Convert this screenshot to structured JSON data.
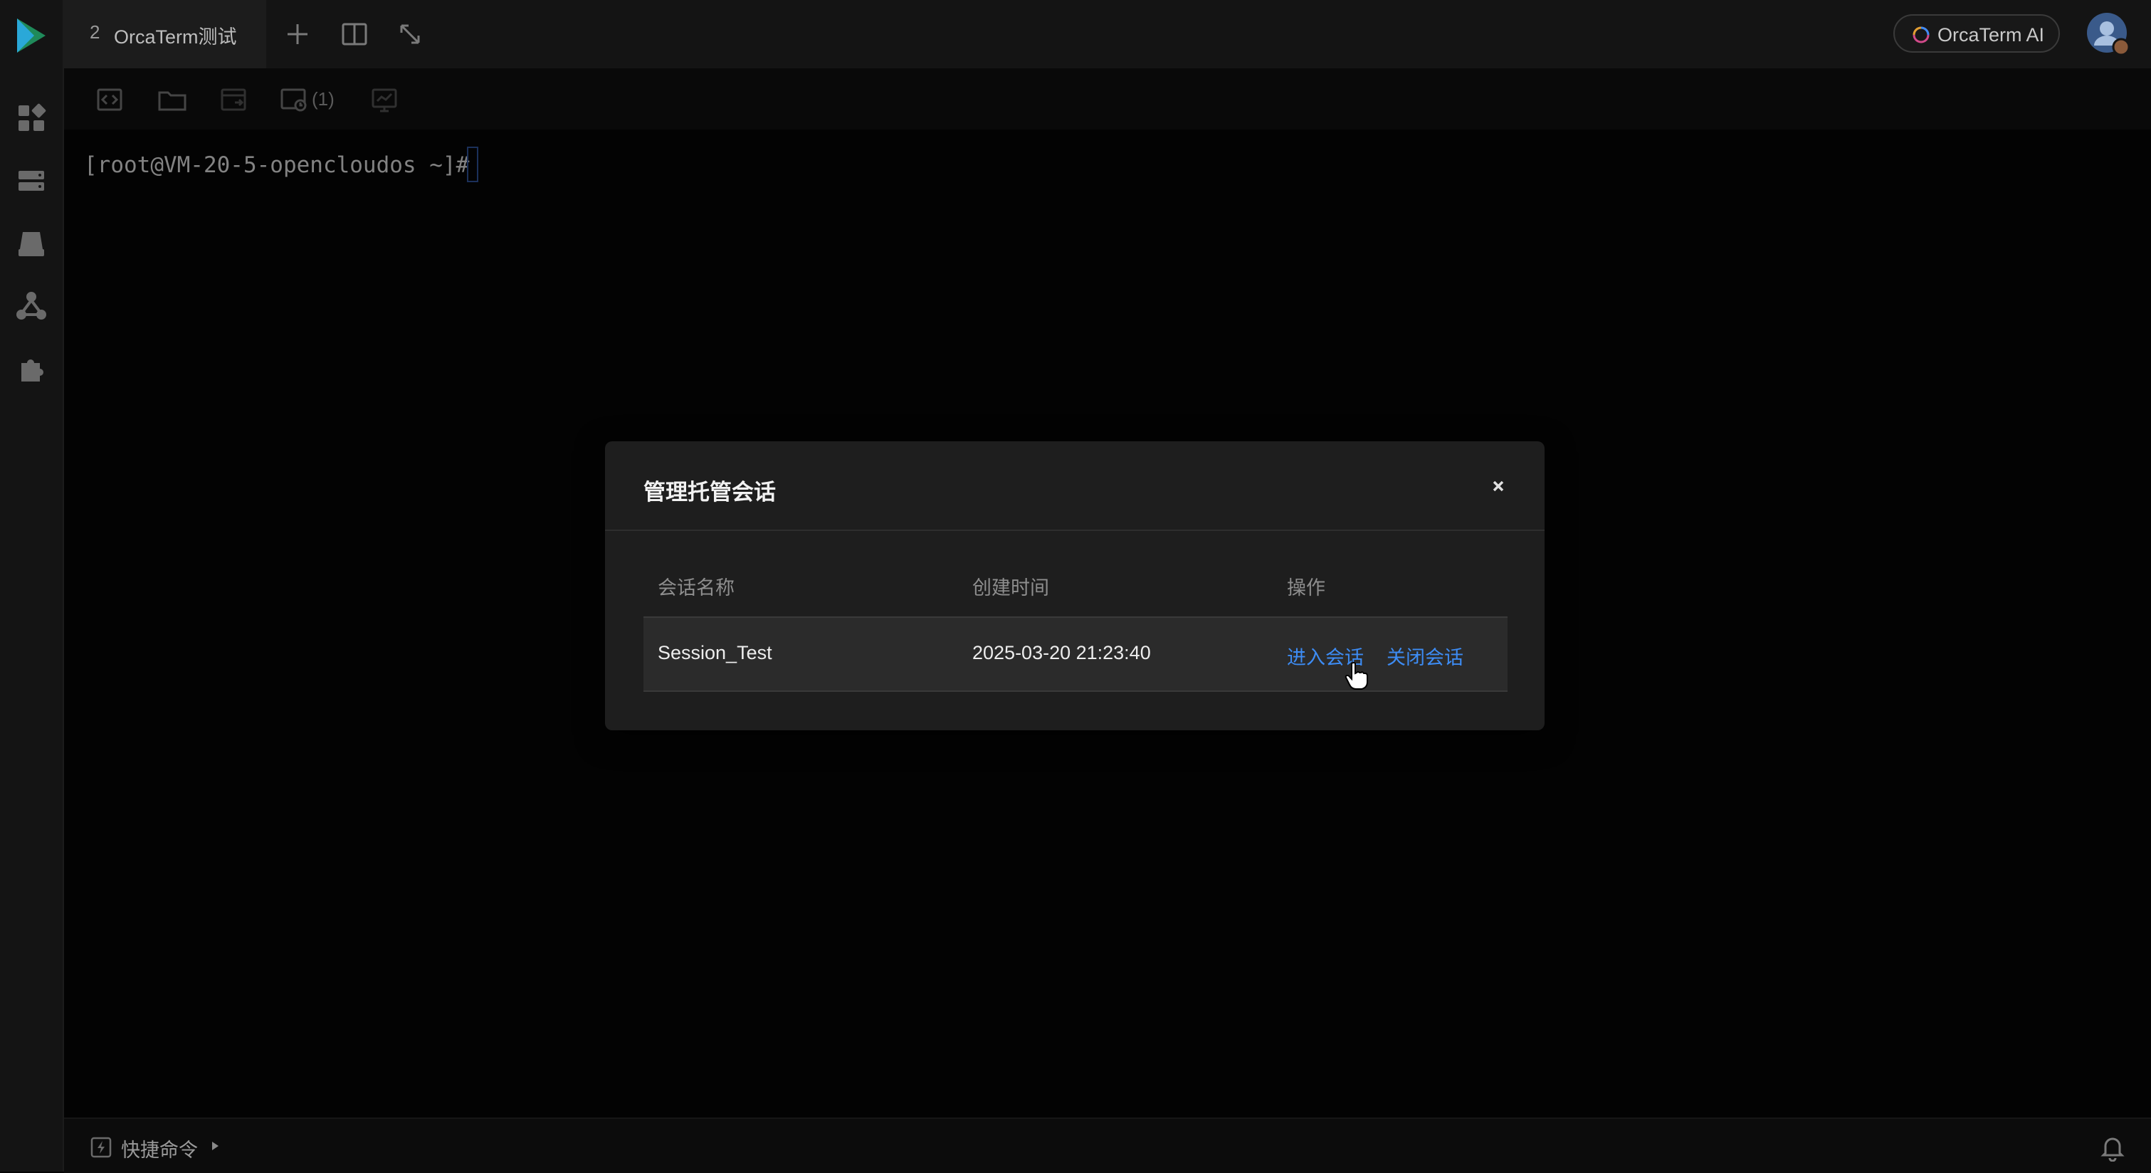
{
  "tab": {
    "number": "2",
    "title": "OrcaTerm测试"
  },
  "ai_button": {
    "label": "OrcaTerm AI"
  },
  "toolbar": {
    "monitor_count": "(1)"
  },
  "terminal": {
    "prompt": "[root@VM-20-5-opencloudos ~]#"
  },
  "modal": {
    "title": "管理托管会话",
    "columns": [
      "会话名称",
      "创建时间",
      "操作"
    ],
    "rows": [
      {
        "name": "Session_Test",
        "created": "2025-03-20 21:23:40",
        "enter_label": "进入会话",
        "close_label": "关闭会话"
      }
    ]
  },
  "bottom": {
    "quick_command_label": "快捷命令"
  },
  "colors": {
    "accent": "#3d8cf4",
    "background": "#050505",
    "panel": "#1e1e1e"
  }
}
